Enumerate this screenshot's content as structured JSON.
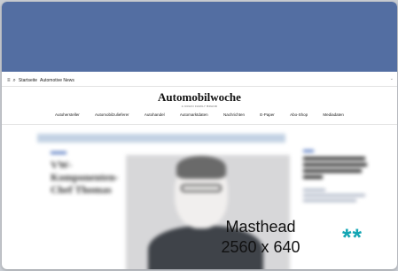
{
  "banner": {
    "color": "#536ea2"
  },
  "topbar": {
    "menu_icon": "hamburger-menu-icon",
    "search_icon": "search-icon",
    "home_link": "Startseite",
    "section_link": "Automotive News",
    "chevron_icon": "chevron-down-icon"
  },
  "brand": {
    "title": "Automobilwoche",
    "tagline": "A CRAIN FAMILY BRAND"
  },
  "nav": {
    "items": [
      "Autohersteller",
      "Automobilzulieferer",
      "Autohandel",
      "Automarktdaten",
      "Nachrichten",
      "E-Paper",
      "Abo-Shop",
      "Mediadaten"
    ]
  },
  "article": {
    "headline_lines": [
      "VW-",
      "Komponenten-",
      "Chef Thomas"
    ],
    "image": "portrait-of-man-with-glasses"
  },
  "ad_label": {
    "line1": "Masthead",
    "line2": "2560 x 640",
    "stars": "**",
    "accent_color": "#14a6b4"
  }
}
